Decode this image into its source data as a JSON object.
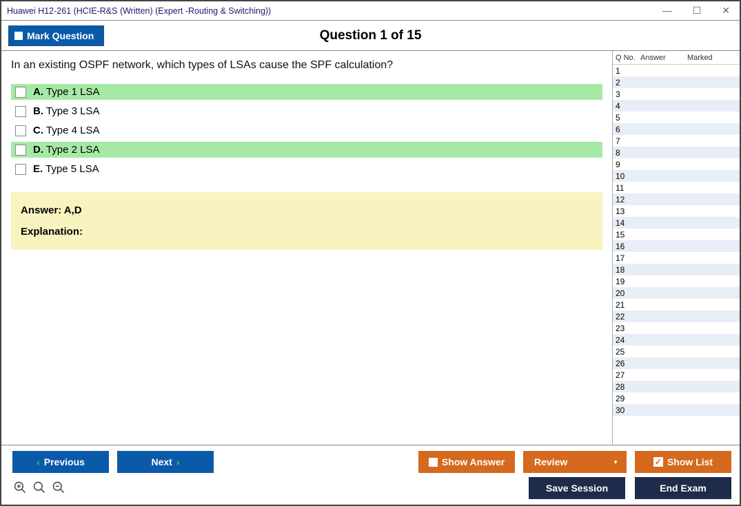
{
  "window": {
    "title": "Huawei H12-261 (HCIE-R&S (Written) (Expert -Routing & Switching))"
  },
  "header": {
    "mark_label": "Mark Question",
    "question_title": "Question 1 of 15"
  },
  "question": {
    "text": "In an existing OSPF network, which types of LSAs cause the SPF calculation?",
    "choices": [
      {
        "letter": "A.",
        "text": "Type 1 LSA",
        "correct": true
      },
      {
        "letter": "B.",
        "text": "Type 3 LSA",
        "correct": false
      },
      {
        "letter": "C.",
        "text": "Type 4 LSA",
        "correct": false
      },
      {
        "letter": "D.",
        "text": "Type 2 LSA",
        "correct": true
      },
      {
        "letter": "E.",
        "text": "Type 5 LSA",
        "correct": false
      }
    ]
  },
  "answer": {
    "label": "Answer: A,D",
    "explanation_label": "Explanation:"
  },
  "sidebar": {
    "headers": {
      "qno": "Q No.",
      "answer": "Answer",
      "marked": "Marked"
    },
    "rows": [
      1,
      2,
      3,
      4,
      5,
      6,
      7,
      8,
      9,
      10,
      11,
      12,
      13,
      14,
      15,
      16,
      17,
      18,
      19,
      20,
      21,
      22,
      23,
      24,
      25,
      26,
      27,
      28,
      29,
      30
    ]
  },
  "footer": {
    "previous": "Previous",
    "next": "Next",
    "show_answer": "Show Answer",
    "review": "Review",
    "show_list": "Show List",
    "save_session": "Save Session",
    "end_exam": "End Exam"
  }
}
